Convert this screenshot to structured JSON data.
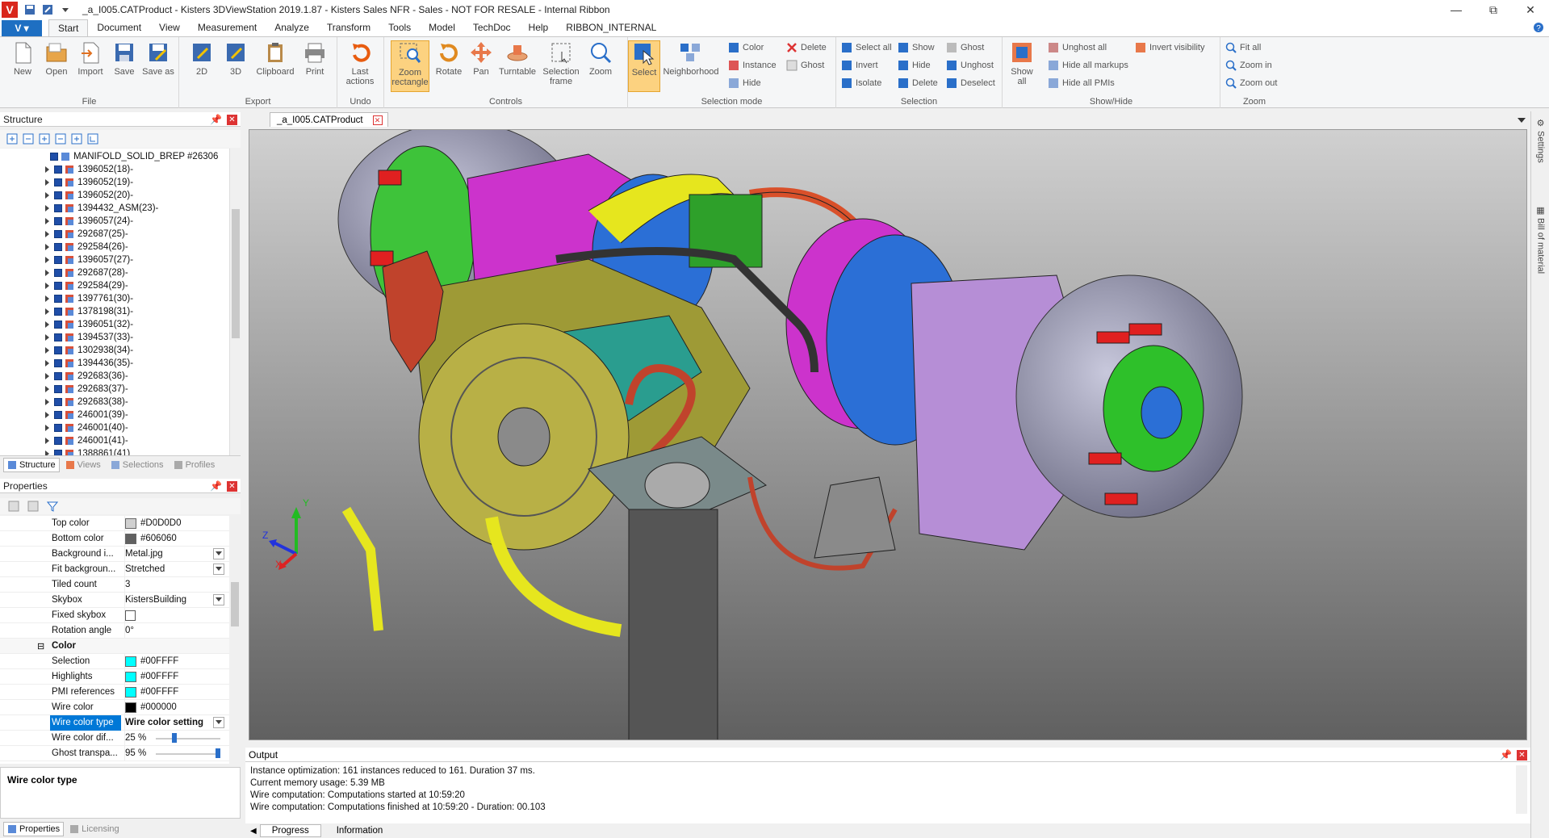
{
  "window": {
    "title": "_a_I005.CATProduct - Kisters 3DViewStation 2019.1.87 - Kisters Sales NFR - Sales - NOT FOR RESALE - Internal Ribbon",
    "app_logo": "V",
    "app_menu": "V"
  },
  "ribbon_tabs": [
    "Start",
    "Document",
    "View",
    "Measurement",
    "Analyze",
    "Transform",
    "Tools",
    "Model",
    "TechDoc",
    "Help",
    "RIBBON_INTERNAL"
  ],
  "ribbon": {
    "file": {
      "label": "File",
      "buttons": [
        "New",
        "Open",
        "Import",
        "Save",
        "Save as"
      ]
    },
    "export": {
      "label": "Export",
      "buttons": [
        "2D",
        "3D",
        "Clipboard",
        "Print"
      ]
    },
    "undo": {
      "label": "Undo",
      "buttons": [
        "Last actions"
      ]
    },
    "controls": {
      "label": "Controls",
      "buttons": [
        "Zoom rectangle",
        "Rotate",
        "Pan",
        "Turntable",
        "Selection frame",
        "Zoom"
      ]
    },
    "selection_mode": {
      "label": "Selection mode",
      "big": [
        "Select",
        "Neighborhood"
      ],
      "small": [
        "Color",
        "Instance",
        "Hide",
        "Delete",
        "Ghost"
      ]
    },
    "selection": {
      "label": "Selection",
      "small": [
        "Select all",
        "Invert",
        "Isolate",
        "Show",
        "Hide",
        "Delete",
        "Ghost",
        "Unghost",
        "Deselect"
      ]
    },
    "show_hide": {
      "label": "Show/Hide",
      "big": [
        "Show all"
      ],
      "small": [
        "Unghost all",
        "Hide all markups",
        "Hide all PMIs",
        "Invert visibility"
      ]
    },
    "zoom": {
      "label": "Zoom",
      "small": [
        "Fit all",
        "Zoom in",
        "Zoom out"
      ]
    }
  },
  "structure": {
    "title": "Structure",
    "items": [
      "MANIFOLD_SOLID_BREP #26306",
      "1396052(18)-",
      "1396052(19)-",
      "1396052(20)-",
      "1394432_ASM(23)-",
      "1396057(24)-",
      "292687(25)-",
      "292584(26)-",
      "1396057(27)-",
      "292687(28)-",
      "292584(29)-",
      "1397761(30)-",
      "1378198(31)-",
      "1396051(32)-",
      "1394537(33)-",
      "1302938(34)-",
      "1394436(35)-",
      "292683(36)-",
      "292683(37)-",
      "292683(38)-",
      "246001(39)-",
      "246001(40)-",
      "246001(41)-",
      "1388861(41)"
    ],
    "tabs": [
      "Structure",
      "Views",
      "Selections",
      "Profiles"
    ]
  },
  "properties": {
    "title": "Properties",
    "rows": [
      {
        "name": "Top color",
        "value": "#D0D0D0",
        "swatch": "#d0d0d0"
      },
      {
        "name": "Bottom color",
        "value": "#606060",
        "swatch": "#606060"
      },
      {
        "name": "Background i...",
        "value": "Metal.jpg",
        "dropdown": true
      },
      {
        "name": "Fit backgroun...",
        "value": "Stretched",
        "dropdown": true
      },
      {
        "name": "Tiled count",
        "value": "3"
      },
      {
        "name": "Skybox",
        "value": "KistersBuilding",
        "dropdown": true
      },
      {
        "name": "Fixed skybox",
        "value": "",
        "checkbox": true
      },
      {
        "name": "Rotation angle",
        "value": "0°"
      }
    ],
    "section": "Color",
    "color_rows": [
      {
        "name": "Selection",
        "value": "#00FFFF",
        "swatch": "#00ffff"
      },
      {
        "name": "Highlights",
        "value": "#00FFFF",
        "swatch": "#00ffff"
      },
      {
        "name": "PMI references",
        "value": "#00FFFF",
        "swatch": "#00ffff"
      },
      {
        "name": "Wire color",
        "value": "#000000",
        "swatch": "#000000"
      },
      {
        "name": "Wire color type",
        "value": "Wire color setting",
        "dropdown": true,
        "selected": true
      },
      {
        "name": "Wire color dif...",
        "value": "25 %",
        "slider": 0.25
      },
      {
        "name": "Ghost transpa...",
        "value": "95 %",
        "slider": 0.95
      }
    ],
    "description": "Wire color type",
    "tabs": [
      "Properties",
      "Licensing"
    ]
  },
  "document": {
    "tab": "_a_I005.CATProduct"
  },
  "axes": {
    "x": "X",
    "y": "Y",
    "z": "Z"
  },
  "side_tabs": [
    "Settings",
    "Bill of material"
  ],
  "output": {
    "title": "Output",
    "lines": [
      "Instance optimization: 161 instances reduced to 161. Duration 37 ms.",
      "Current memory usage: 5.39 MB",
      "Wire computation: Computations started at 10:59:20",
      "Wire computation: Computations finished at 10:59:20 - Duration: 00.103"
    ],
    "tabs": [
      "Progress",
      "Information"
    ]
  },
  "colors": {
    "accent": "#1e6fc2",
    "select_highlight": "#fcd280",
    "selected_row": "#0078d7"
  }
}
